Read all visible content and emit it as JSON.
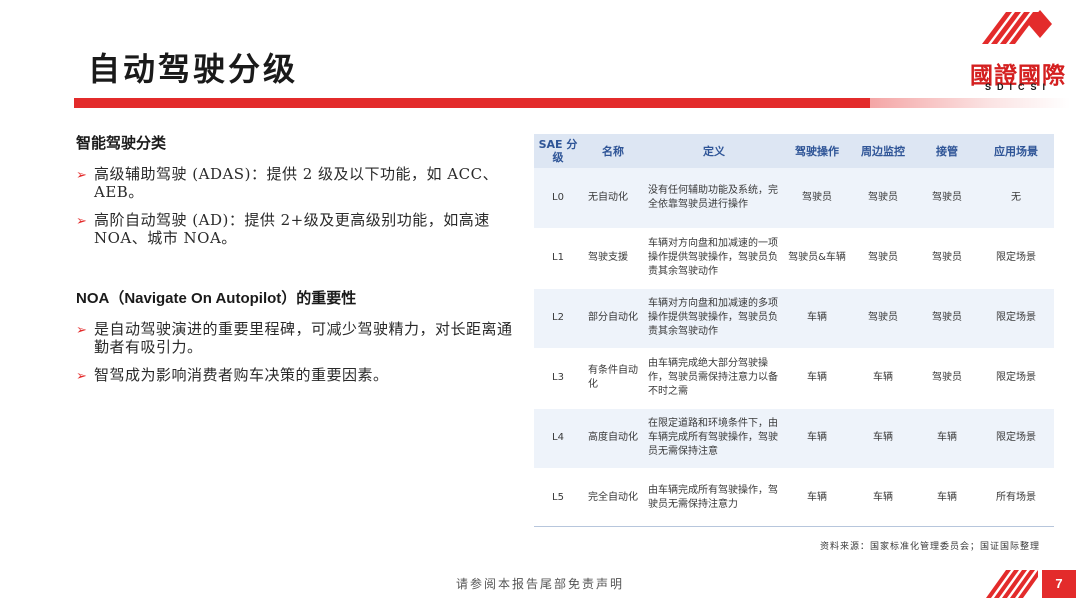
{
  "page": {
    "title": "自动驾驶分级",
    "page_number": "7",
    "footer_note": "请参阅本报告尾部免责声明",
    "source": "资料来源：国家标准化管理委员会；国证国际整理"
  },
  "brand": {
    "logo_text": "國證國際",
    "logo_sub": "SDICSI",
    "accent": "#e32b2b"
  },
  "classification": {
    "heading": "智能驾驶分类",
    "bullets": [
      "高级辅助驾驶 (ADAS)：提供 2 级及以下功能，如 ACC、AEB。",
      "高阶自动驾驶 (AD)：提供 2+级及更高级别功能，如高速 NOA、城市 NOA。"
    ]
  },
  "noa": {
    "heading": "NOA（Navigate On Autopilot）的重要性",
    "bullets": [
      "是自动驾驶演进的重要里程碑，可减少驾驶精力，对长距离通勤者有吸引力。",
      "智驾成为影响消费者购车决策的重要因素。"
    ]
  },
  "table": {
    "headers": [
      "SAE 分级",
      "名称",
      "定义",
      "驾驶操作",
      "周边监控",
      "接管",
      "应用场景"
    ],
    "rows": [
      [
        "L0",
        "无自动化",
        "没有任何辅助功能及系统，完全依靠驾驶员进行操作",
        "驾驶员",
        "驾驶员",
        "驾驶员",
        "无"
      ],
      [
        "L1",
        "驾驶支援",
        "车辆对方向盘和加减速的一项操作提供驾驶操作，驾驶员负责其余驾驶动作",
        "驾驶员&车辆",
        "驾驶员",
        "驾驶员",
        "限定场景"
      ],
      [
        "L2",
        "部分自动化",
        "车辆对方向盘和加减速的多项操作提供驾驶操作，驾驶员负责其余驾驶动作",
        "车辆",
        "驾驶员",
        "驾驶员",
        "限定场景"
      ],
      [
        "L3",
        "有条件自动化",
        "由车辆完成绝大部分驾驶操作，驾驶员需保持注意力以备不时之需",
        "车辆",
        "车辆",
        "驾驶员",
        "限定场景"
      ],
      [
        "L4",
        "高度自动化",
        "在限定道路和环境条件下，由车辆完成所有驾驶操作，驾驶员无需保持注意",
        "车辆",
        "车辆",
        "车辆",
        "限定场景"
      ],
      [
        "L5",
        "完全自动化",
        "由车辆完成所有驾驶操作，驾驶员无需保持注意力",
        "车辆",
        "车辆",
        "车辆",
        "所有场景"
      ]
    ]
  }
}
